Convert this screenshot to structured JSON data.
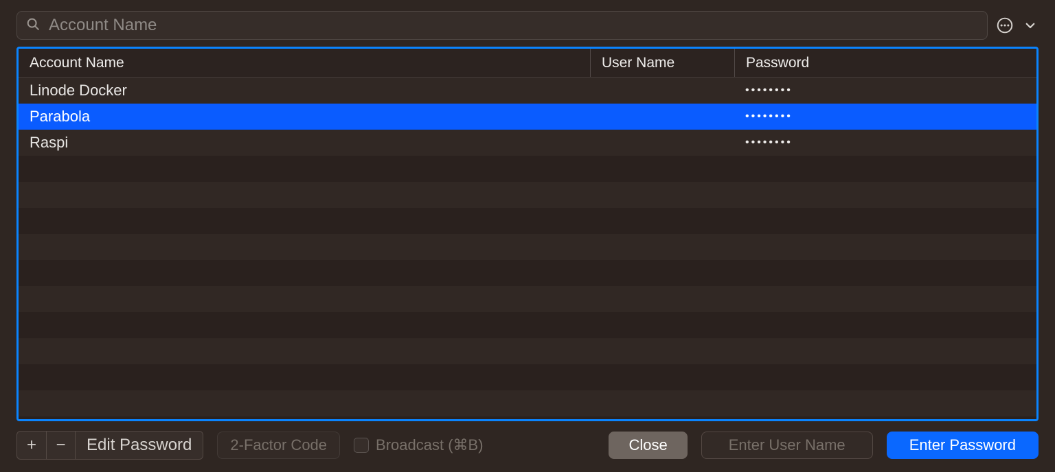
{
  "search": {
    "placeholder": "Account Name",
    "value": ""
  },
  "columns": {
    "account": "Account Name",
    "user": "User Name",
    "password": "Password"
  },
  "rows": [
    {
      "account": "Linode Docker",
      "user": "",
      "password": "••••••••",
      "selected": false
    },
    {
      "account": "Parabola",
      "user": "",
      "password": "••••••••",
      "selected": true
    },
    {
      "account": "Raspi",
      "user": "",
      "password": "••••••••",
      "selected": false
    }
  ],
  "footer": {
    "add": "+",
    "remove": "−",
    "edit": "Edit Password",
    "two_factor": "2-Factor Code",
    "broadcast": "Broadcast (⌘B)",
    "close": "Close",
    "user_placeholder": "Enter User Name",
    "enter_password": "Enter Password"
  }
}
